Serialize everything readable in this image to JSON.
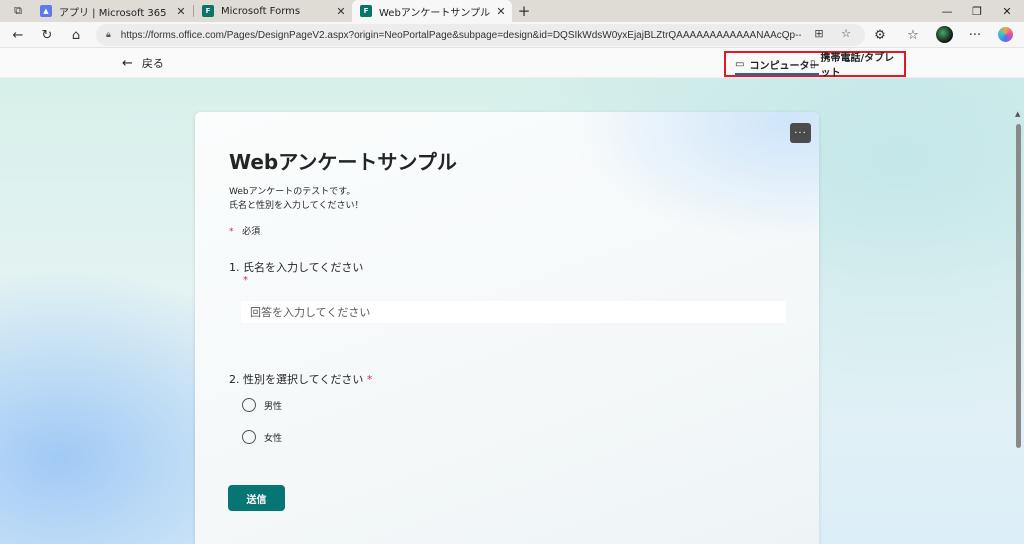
{
  "browser": {
    "tabs": [
      {
        "title": "アプリ | Microsoft 365",
        "favicon": "m365-icon",
        "color": "#5b7be8"
      },
      {
        "title": "Microsoft Forms",
        "favicon": "forms-icon",
        "color": "#077568"
      },
      {
        "title": "Webアンケートサンプル (プレビュー)",
        "favicon": "forms-icon",
        "color": "#077568"
      }
    ],
    "new_tab_glyph": "+",
    "window": {
      "minimize": "—",
      "restore": "❐",
      "close": "✕"
    },
    "url": "https://forms.office.com/Pages/DesignPageV2.aspx?origin=NeoPortalPage&subpage=design&id=DQSIkWdsW0yxEjajBLZtrQAAAAAAAAAAAANAAcQp--xUNEZB..."
  },
  "header": {
    "back_label": "戻る",
    "view_desktop": "コンピューター",
    "view_mobile": "携帯電話/タブレット",
    "highlight_color": "#e01b24"
  },
  "form": {
    "title": "Webアンケートサンプル",
    "description_line1": "Webアンケートのテストです。",
    "description_line2": "氏名と性別を入力してください！",
    "required_note": "必須",
    "required_star": "*",
    "more_glyph": "···",
    "q1": {
      "label": "1. 氏名を入力してください",
      "placeholder": "回答を入力してください"
    },
    "q2": {
      "label": "2. 性別を選択してください",
      "options": [
        "男性",
        "女性"
      ]
    },
    "submit_label": "送信",
    "accent_color": "#087575"
  }
}
